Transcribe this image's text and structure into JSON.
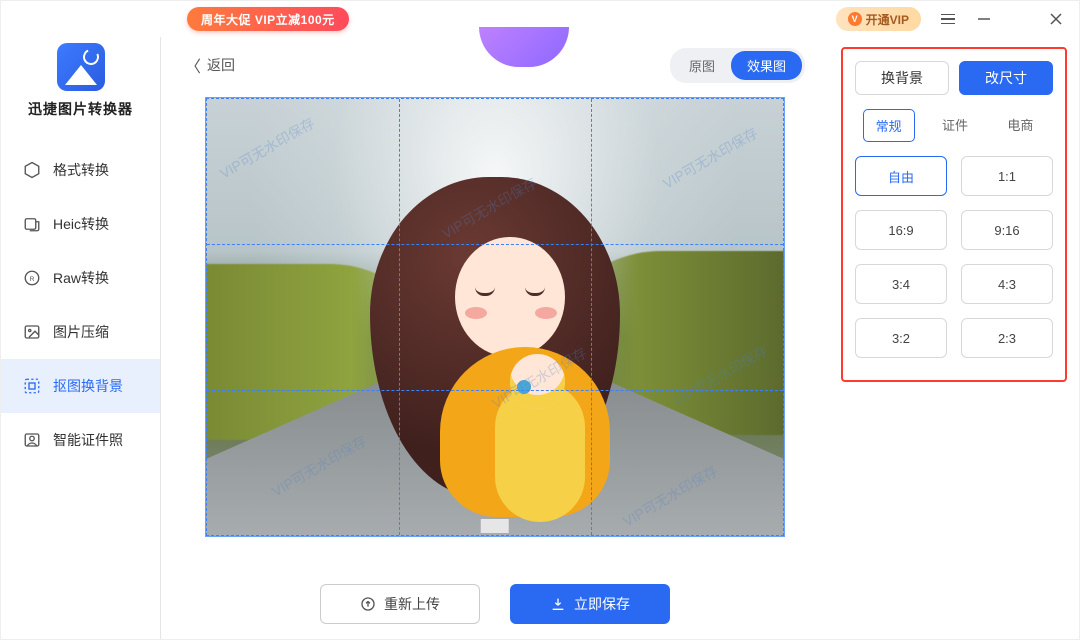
{
  "titlebar": {
    "promo": "周年大促 VIP立减100元",
    "vip_label": "开通VIP"
  },
  "app": {
    "title": "迅捷图片转换器"
  },
  "sidebar": {
    "items": [
      {
        "label": "格式转换"
      },
      {
        "label": "Heic转换"
      },
      {
        "label": "Raw转换"
      },
      {
        "label": "图片压缩"
      },
      {
        "label": "抠图换背景"
      },
      {
        "label": "智能证件照"
      }
    ]
  },
  "toolbar": {
    "back": "返回",
    "toggle_original": "原图",
    "toggle_effect": "效果图"
  },
  "watermark": "VIP可无水印保存",
  "actions": {
    "reupload": "重新上传",
    "save": "立即保存"
  },
  "panel": {
    "seg_bg": "换背景",
    "seg_size": "改尺寸",
    "tabs": {
      "normal": "常规",
      "id": "证件",
      "ecom": "电商"
    },
    "ratios": [
      "自由",
      "1:1",
      "16:9",
      "9:16",
      "3:4",
      "4:3",
      "3:2",
      "2:3"
    ]
  }
}
